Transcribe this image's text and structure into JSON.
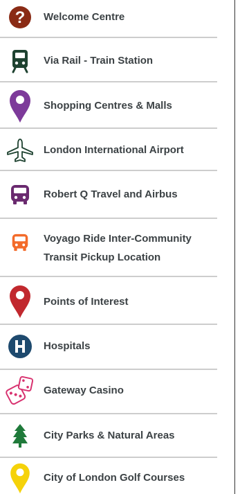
{
  "legend": {
    "items": [
      {
        "label": "Welcome Centre",
        "icon": "question-circle-icon",
        "color": "#8a2b15"
      },
      {
        "label": "Via Rail - Train Station",
        "icon": "train-icon",
        "color": "#1e4230"
      },
      {
        "label": "Shopping Centres & Malls",
        "icon": "map-pin-icon",
        "color": "#7d3a9a"
      },
      {
        "label": "London International Airport",
        "icon": "airplane-icon",
        "color": "#1e4230"
      },
      {
        "label": "Robert Q Travel and Airbus",
        "icon": "bus-icon",
        "color": "#6a2a6f"
      },
      {
        "label": "Voyago Ride Inter-Community\nTransit Pickup Location",
        "icon": "bus-icon",
        "color": "#f36b2a"
      },
      {
        "label": "Points of Interest",
        "icon": "map-pin-icon",
        "color": "#c1282e"
      },
      {
        "label": "Hospitals",
        "icon": "hospital-icon",
        "color": "#1e4a6e"
      },
      {
        "label": "Gateway Casino",
        "icon": "dice-icon",
        "color": "#d8316f"
      },
      {
        "label": "City Parks & Natural Areas",
        "icon": "tree-icon",
        "color": "#1f7a3a"
      },
      {
        "label": "City of London Golf Courses",
        "icon": "map-pin-icon",
        "color": "#f5d20a"
      }
    ]
  },
  "colors": {
    "text": "#3c4245",
    "divider": "#cdcdcd",
    "border": "#333333"
  }
}
